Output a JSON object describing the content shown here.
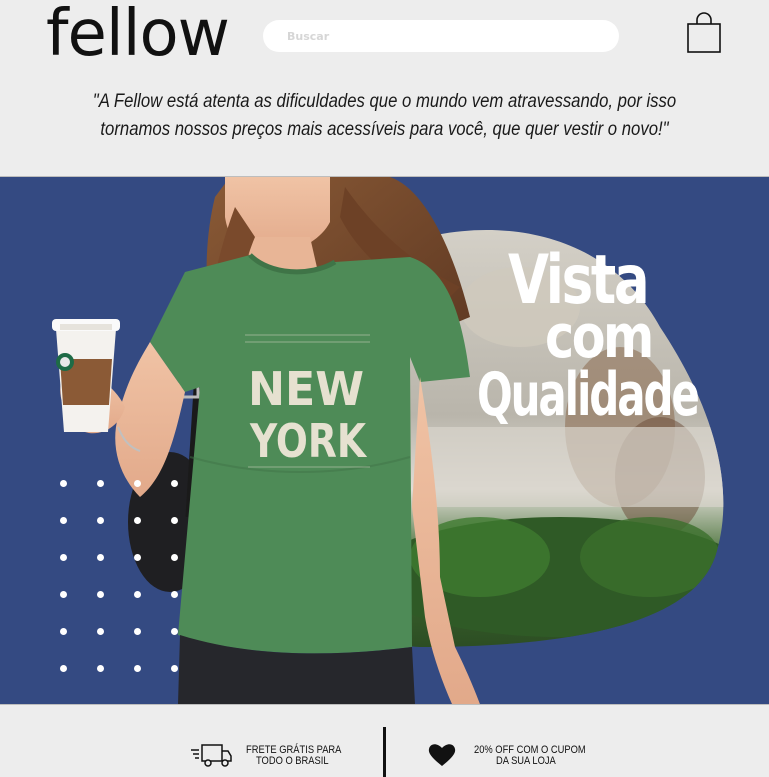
{
  "header": {
    "logo": "fellow",
    "search_placeholder": "Buscar",
    "quote": "\"A Fellow está atenta as dificuldades que o mundo vem atravessando, por isso tornamos nossos preços mais acessíveis para você, que quer vestir o novo!\""
  },
  "hero": {
    "headline": [
      "Vista",
      "com",
      "Qualidade"
    ],
    "shirt_text": [
      "NEW",
      "YORK"
    ],
    "background_color": "#344a82",
    "shirt_color": "#4e8b57"
  },
  "features": [
    {
      "icon": "truck-icon",
      "line1": "FRETE GRÁTIS PARA",
      "line2": "TODO O BRASIL"
    },
    {
      "icon": "heart-icon",
      "line1": "20% OFF COM O CUPOM",
      "line2": "DA SUA LOJA"
    }
  ]
}
